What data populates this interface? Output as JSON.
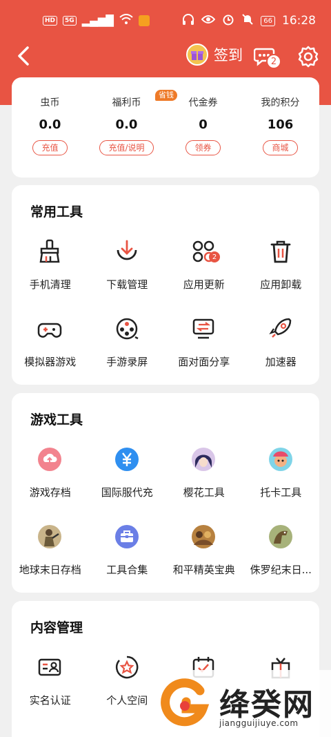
{
  "status_bar": {
    "left_chips": [
      "HD",
      "5G"
    ],
    "battery": "66",
    "time": "16:28"
  },
  "nav": {
    "signin_label": "签到",
    "message_badge": "2"
  },
  "wallet": [
    {
      "label": "虫币",
      "value": "0.0",
      "button": "充值"
    },
    {
      "label": "福利币",
      "value": "0.0",
      "button": "充值/说明",
      "badge": "省钱"
    },
    {
      "label": "代金券",
      "value": "0",
      "button": "领券"
    },
    {
      "label": "我的积分",
      "value": "106",
      "button": "商城"
    }
  ],
  "sections": {
    "common_tools": {
      "title": "常用工具",
      "items": [
        {
          "label": "手机清理",
          "icon": "broom-icon"
        },
        {
          "label": "下载管理",
          "icon": "download-icon"
        },
        {
          "label": "应用更新",
          "icon": "app-update-icon",
          "badge": "2"
        },
        {
          "label": "应用卸载",
          "icon": "trash-icon"
        },
        {
          "label": "模拟器游戏",
          "icon": "gamepad-icon"
        },
        {
          "label": "手游录屏",
          "icon": "film-reel-icon"
        },
        {
          "label": "面对面分享",
          "icon": "face-to-face-share-icon"
        },
        {
          "label": "加速器",
          "icon": "rocket-icon"
        }
      ]
    },
    "game_tools": {
      "title": "游戏工具",
      "items": [
        {
          "label": "游戏存档",
          "icon": "cloud-upload-icon"
        },
        {
          "label": "国际服代充",
          "icon": "yen-icon"
        },
        {
          "label": "樱花工具",
          "icon": "anime-girl-avatar"
        },
        {
          "label": "托卡工具",
          "icon": "toca-character-avatar"
        },
        {
          "label": "地球末日存档",
          "icon": "soldier-avatar"
        },
        {
          "label": "工具合集",
          "icon": "toolbox-icon"
        },
        {
          "label": "和平精英宝典",
          "icon": "pubg-avatar"
        },
        {
          "label": "侏罗纪末日...",
          "icon": "dinosaur-avatar"
        }
      ]
    },
    "content_mgmt": {
      "title": "内容管理",
      "items": [
        {
          "label": "实名认证",
          "icon": "id-card-icon"
        },
        {
          "label": "个人空间",
          "icon": "star-badge-icon"
        },
        {
          "label": "",
          "icon": "calendar-check-icon"
        },
        {
          "label": "",
          "icon": "gift-box-icon"
        }
      ]
    }
  },
  "watermark": {
    "name": "绛癸网",
    "url": "jiangguijiuye.com"
  },
  "colors": {
    "accent": "#e85443",
    "orange": "#ee7a28"
  }
}
